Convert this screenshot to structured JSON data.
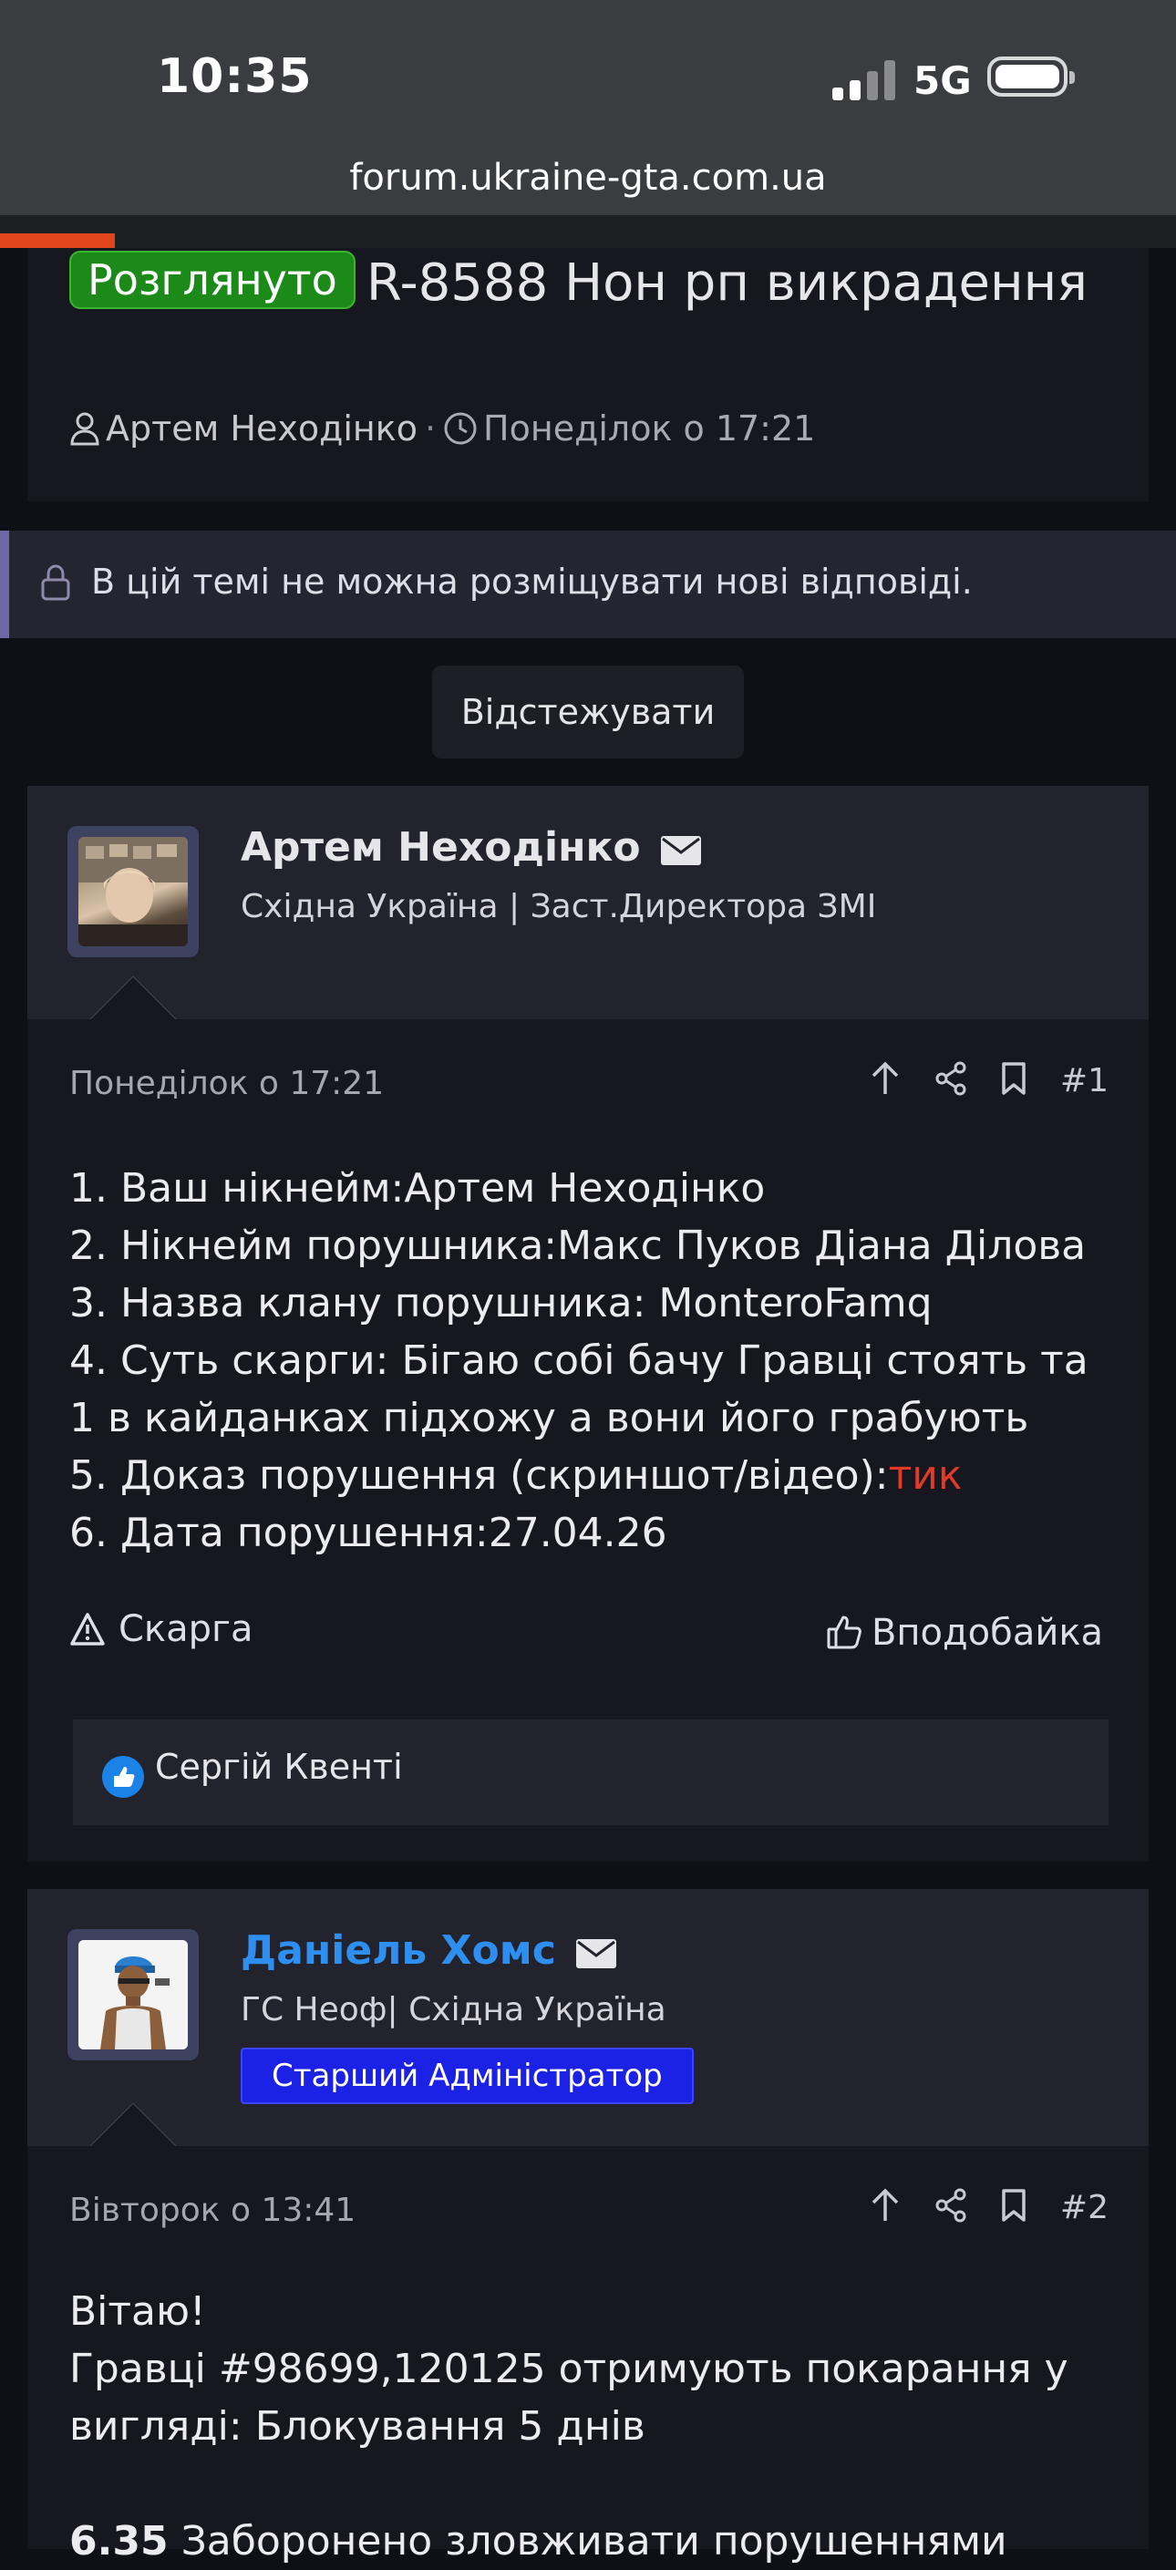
{
  "status_bar": {
    "time": "10:35",
    "network": "5G"
  },
  "browser": {
    "url": "forum.ukraine-gta.com.ua"
  },
  "thread": {
    "status_badge": "Розглянуто",
    "title": "R-8588 Нон рп викрадення",
    "author": "Артем Неходінко",
    "separator": "·",
    "date": "Понеділок о 17:21"
  },
  "locked_notice": "В цій темі не можна розміщувати нові відповіді.",
  "follow_button": "Відстежувати",
  "posts": [
    {
      "username": "Артем Неходінко",
      "user_title": "Східна Україна | Заст.Директора ЗМІ",
      "date": "Понеділок о 17:21",
      "number": "#1",
      "lines": [
        "1. Ваш нікнейм:Артем Неходінко",
        "2. Нікнейм порушника:Макс Пуков Діана Ділова",
        "3. Назва клану порушника: MonteroFamq",
        "4. Суть скарги: Бігаю собі бачу Гравці стоять та 1 в кайданках підхожу а вони його грабують",
        "5. Доказ порушення (скриншот/відео):",
        "6. Дата порушення:27.04.26"
      ],
      "evidence_link": "тик",
      "report_label": "Скарга",
      "like_label": "Вподобайка",
      "reactions": "Сергій Квенті"
    },
    {
      "username": "Даніель Хомс",
      "user_title": "ГС Неоф| Східна Україна",
      "staff_badge": "Старший Адміністратор",
      "date": "Вівторок о 13:41",
      "number": "#2",
      "line1": "Вітаю!",
      "line2": "Гравці #98699,120125 отримують покарання у вигляді: Блокування 5 днів",
      "rule_num": "6.35",
      "rule_text": "Заборонено зловживати порушеннями"
    }
  ],
  "colors": {
    "accent_green": "#1c8a18",
    "staff_name": "#2f8ff0",
    "staff_badge": "#1b22e6",
    "link_red": "#e23a2a",
    "progress": "#e0451c"
  }
}
